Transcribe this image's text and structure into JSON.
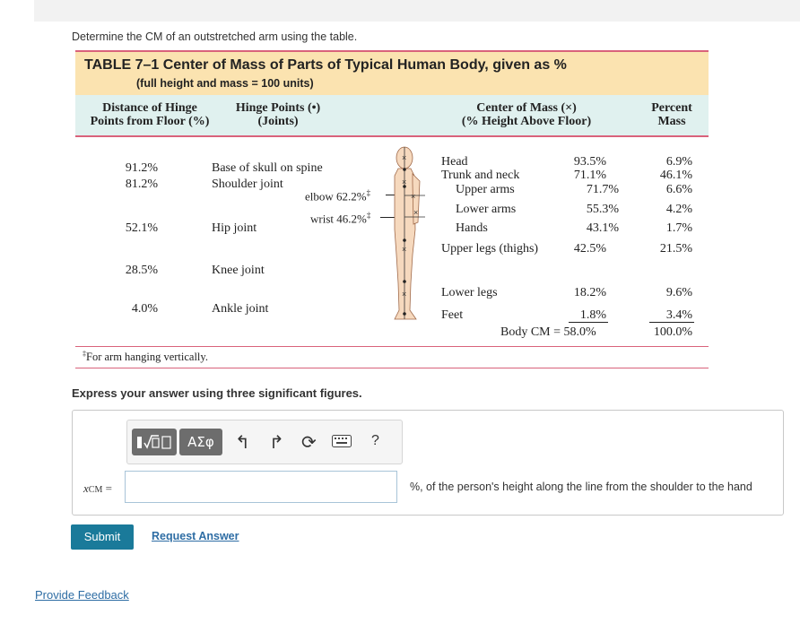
{
  "prompt": "Determine the CM of an outstretched arm using the table.",
  "table": {
    "title": "TABLE 7–1  Center of Mass of Parts of Typical Human Body, given as %",
    "subtitle": "(full height and mass = 100 units)",
    "col1": [
      "Distance of Hinge",
      "Points from Floor (%)"
    ],
    "col2": [
      "Hinge Points (•)",
      "(Joints)"
    ],
    "col3": [
      "Center of Mass (×)",
      "(% Height Above Floor)"
    ],
    "col4": [
      "Percent",
      "Mass"
    ],
    "hinges": [
      {
        "dist": "91.2%",
        "name": "Base of skull on spine"
      },
      {
        "dist": "81.2%",
        "name": "Shoulder joint"
      },
      {
        "dist": "52.1%",
        "name": "Hip joint"
      },
      {
        "dist": "28.5%",
        "name": "Knee joint"
      },
      {
        "dist": "4.0%",
        "name": "Ankle joint"
      }
    ],
    "arm_labels": {
      "elbow": "elbow 62.2%",
      "wrist": "wrist 46.2%"
    },
    "parts": [
      {
        "name": "Head",
        "cm": "93.5%",
        "mass": "6.9%"
      },
      {
        "name": "Trunk and neck",
        "cm": "71.1%",
        "mass": "46.1%"
      },
      {
        "name": "Upper arms",
        "cm": "71.7%",
        "mass": "6.6%"
      },
      {
        "name": "Lower arms",
        "cm": "55.3%",
        "mass": "4.2%"
      },
      {
        "name": "Hands",
        "cm": "43.1%",
        "mass": "1.7%"
      },
      {
        "name": "Upper legs (thighs)",
        "cm": "42.5%",
        "mass": "21.5%"
      },
      {
        "name": "Lower legs",
        "cm": "18.2%",
        "mass": "9.6%"
      },
      {
        "name": "Feet",
        "cm": "1.8%",
        "mass": "3.4%"
      }
    ],
    "body_cm_label": "Body CM =",
    "body_cm": "58.0%",
    "mass_total": "100.0%",
    "footnote": "For arm hanging vertically."
  },
  "instruction": "Express your answer using three significant figures.",
  "toolbar": {
    "symbol_btn": "ΑΣφ",
    "help": "?"
  },
  "answer": {
    "variable": "x",
    "subscript": "CM",
    "equals": "=",
    "value": "",
    "unit_text": "%, of the person's height along the line from the shoulder to the hand"
  },
  "buttons": {
    "submit": "Submit",
    "request": "Request Answer",
    "feedback": "Provide Feedback"
  }
}
